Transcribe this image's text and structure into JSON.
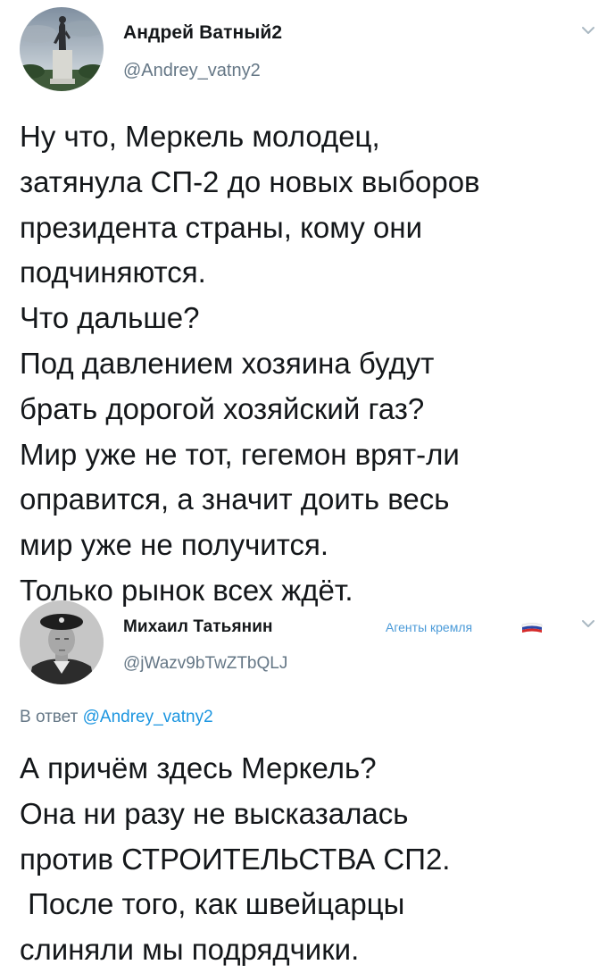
{
  "colors": {
    "text": "#14171a",
    "secondary": "#657786",
    "link": "#1b95e0",
    "group_label": "#4a9ad8"
  },
  "tweet1": {
    "display_name": "Андрей Ватный2",
    "handle": "@Andrey_vatny2",
    "text_lines": [
      "Ну что, Меркель молодец,",
      "затянула СП-2 до новых выборов",
      "президента страны, кому они",
      "подчиняются.",
      "Что дальше?",
      "Под давлением хозяина будут",
      "брать дорогой хозяйский газ?",
      "Мир уже не тот, гегемон врят-ли",
      "оправится, а значит доить весь",
      "мир уже не получится.",
      "Только рынок всех ждёт."
    ],
    "menu_icon": "chevron-down-icon"
  },
  "tweet2": {
    "display_name": "Михаил Татьянин",
    "handle": "@jWazv9bTwZTbQLJ",
    "group_label": "Агенты кремля",
    "flag_icon": "russian-flag-icon",
    "reply_prefix": "В ответ",
    "reply_to": "@Andrey_vatny2",
    "text_lines": [
      "А причём здесь Меркель?",
      "Она ни разу не высказалась",
      "против СТРОИТЕЛЬСТВА СП2.",
      " После того, как швейцарцы",
      "слиняли мы подрядчики."
    ],
    "menu_icon": "chevron-down-icon"
  }
}
